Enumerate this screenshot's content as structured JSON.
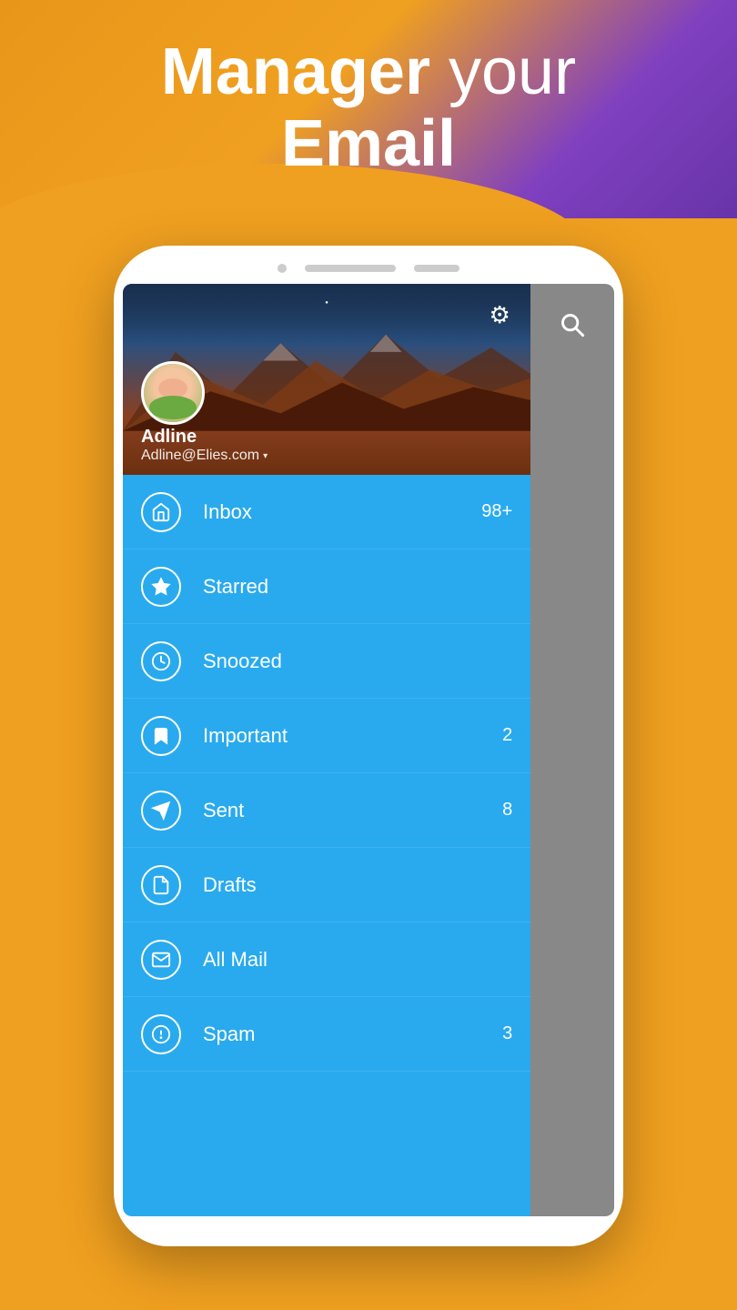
{
  "hero": {
    "line1_bold": "Manager",
    "line1_light": " your",
    "line2": "Email"
  },
  "user": {
    "name": "Adline",
    "email": "Adline@Elies.com"
  },
  "menu": {
    "items": [
      {
        "id": "inbox",
        "label": "Inbox",
        "icon": "inbox",
        "badge": "98+"
      },
      {
        "id": "starred",
        "label": "Starred",
        "icon": "star",
        "badge": ""
      },
      {
        "id": "snoozed",
        "label": "Snoozed",
        "icon": "clock",
        "badge": ""
      },
      {
        "id": "important",
        "label": "Important",
        "icon": "bookmark",
        "badge": "2"
      },
      {
        "id": "sent",
        "label": "Sent",
        "icon": "send",
        "badge": "8"
      },
      {
        "id": "drafts",
        "label": "Drafts",
        "icon": "draft",
        "badge": ""
      },
      {
        "id": "all-mail",
        "label": "All Mail",
        "icon": "mail",
        "badge": ""
      },
      {
        "id": "spam",
        "label": "Spam",
        "icon": "warning",
        "badge": "3"
      }
    ]
  },
  "colors": {
    "drawer_bg": "#29aaee",
    "header_bg_top": "#1a3a5c",
    "right_panel_bg": "#888888"
  }
}
